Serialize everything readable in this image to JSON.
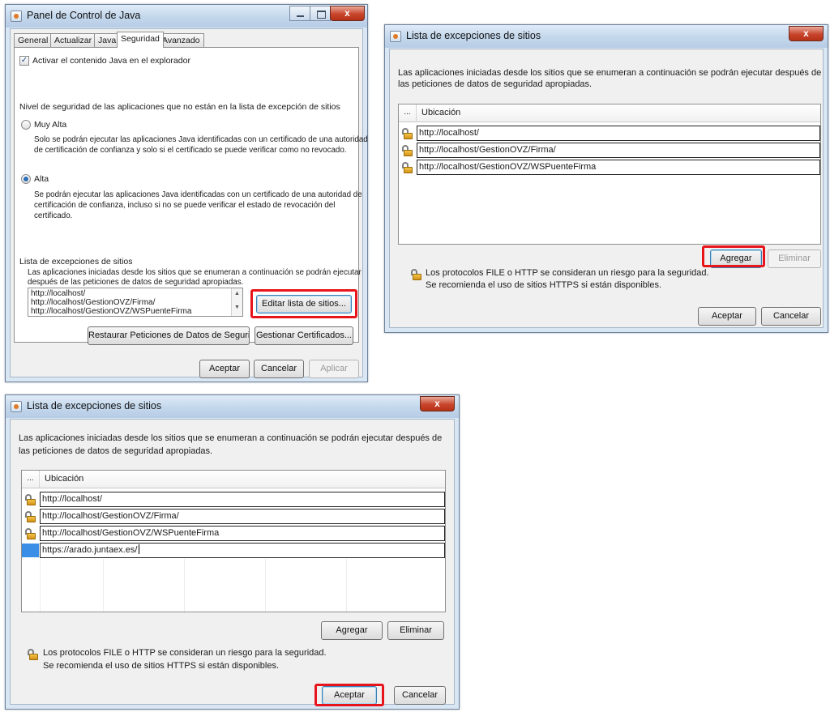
{
  "panel": {
    "title": "Panel de Control de Java",
    "tabs": [
      "General",
      "Actualizar",
      "Java",
      "Seguridad",
      "Avanzado"
    ],
    "active_tab": "Seguridad",
    "enable_java_label": "Activar el contenido Java en el explorador",
    "enable_java_checked": true,
    "security_level_heading": "Nivel de seguridad de las aplicaciones que no están en la lista de excepción de sitios",
    "very_high_label": "Muy Alta",
    "very_high_desc_1": "Solo se podrán ejecutar las aplicaciones Java identificadas con un certificado de una autoridad",
    "very_high_desc_2": "de certificación de confianza y solo si el certificado se puede verificar como no revocado.",
    "high_label": "Alta",
    "high_desc_1": "Se podrán ejecutar las aplicaciones Java identificadas con un certificado de una autoridad de",
    "high_desc_2": "certificación de confianza, incluso si no se puede verificar el estado de revocación del",
    "high_desc_3": "certificado.",
    "exceptions_heading": "Lista de excepciones de sitios",
    "exceptions_desc_1": "Las aplicaciones iniciadas desde los sitios que se enumeran a continuación se podrán ejecutar",
    "exceptions_desc_2": "después de las peticiones de datos de seguridad apropiadas.",
    "sites": [
      "http://localhost/",
      "http://localhost/GestionOVZ/Firma/",
      "http://localhost/GestionOVZ/WSPuenteFirma"
    ],
    "edit_sites_button": "Editar lista de sitios...",
    "restore_button": "Restaurar Peticiones de Datos de Seguridad",
    "manage_certs_button": "Gestionar Certificados...",
    "accept_button": "Aceptar",
    "cancel_button": "Cancelar",
    "apply_button": "Aplicar"
  },
  "dialog1": {
    "title": "Lista de excepciones de sitios",
    "desc_1": "Las aplicaciones iniciadas desde los sitios que se enumeran a continuación se podrán ejecutar después de",
    "desc_2": "las peticiones de datos de seguridad apropiadas.",
    "col_dots": "...",
    "col_location": "Ubicación",
    "rows": [
      "http://localhost/",
      "http://localhost/GestionOVZ/Firma/",
      "http://localhost/GestionOVZ/WSPuenteFirma"
    ],
    "add_button": "Agregar",
    "remove_button": "Eliminar",
    "warning_1": "Los protocolos FILE o HTTP se consideran un riesgo para la seguridad.",
    "warning_2": "Se recomienda el uso de sitios HTTPS si están disponibles.",
    "accept_button": "Aceptar",
    "cancel_button": "Cancelar"
  },
  "dialog2": {
    "title": "Lista de excepciones de sitios",
    "desc_1": "Las aplicaciones iniciadas desde los sitios que se enumeran a continuación se podrán ejecutar después de",
    "desc_2": "las peticiones de datos de seguridad apropiadas.",
    "col_dots": "...",
    "col_location": "Ubicación",
    "rows": [
      "http://localhost/",
      "http://localhost/GestionOVZ/Firma/",
      "http://localhost/GestionOVZ/WSPuenteFirma"
    ],
    "new_row_value": "https://arado.juntaex.es/",
    "add_button": "Agregar",
    "remove_button": "Eliminar",
    "warning_1": "Los protocolos FILE o HTTP se consideran un riesgo para la seguridad.",
    "warning_2": "Se recomienda el uso de sitios HTTPS si están disponibles.",
    "accept_button": "Aceptar",
    "cancel_button": "Cancelar"
  },
  "colors": {
    "highlight": "#e8141c",
    "title_bar": "#c3d7ec",
    "close_button": "#c8452c",
    "radio_selected": "#2a6fb8",
    "new_row_cell": "#3a8ee6"
  },
  "icons": {
    "java": "java-icon",
    "lock": "lock-icon",
    "close": "close-icon",
    "minimize": "minimize-icon",
    "maximize": "maximize-icon"
  }
}
